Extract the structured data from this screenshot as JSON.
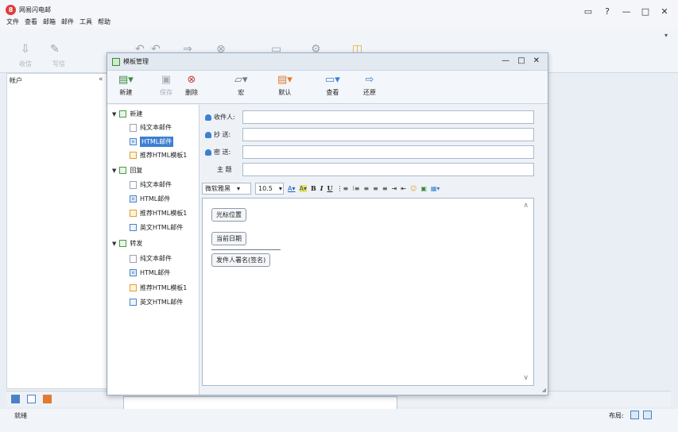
{
  "app": {
    "title": "网易闪电邮",
    "logo_glyph": "8"
  },
  "menu": [
    "文件",
    "查看",
    "邮箱",
    "邮件",
    "工具",
    "帮助"
  ],
  "window_controls": [
    "▭",
    "?",
    "—",
    "□",
    "✕"
  ],
  "main_toolbar_ghost": {
    "receive_label": "收信",
    "write_label": "写信"
  },
  "accounts": {
    "label": "帐户",
    "collapse": "«"
  },
  "right_scroll": "▾",
  "dialog": {
    "title": "模板管理",
    "controls": [
      "—",
      "□",
      "✕"
    ],
    "toolbar": [
      {
        "label": "新建",
        "icon": "new-icon",
        "enabled": true
      },
      {
        "label": "保存",
        "icon": "save-icon",
        "enabled": false
      },
      {
        "label": "删除",
        "icon": "delete-icon",
        "enabled": true
      },
      {
        "label": "宏",
        "icon": "macro-icon",
        "enabled": true
      },
      {
        "label": "默认",
        "icon": "default-icon",
        "enabled": true
      },
      {
        "label": "查看",
        "icon": "view-icon",
        "enabled": true
      },
      {
        "label": "还原",
        "icon": "restore-icon",
        "enabled": true
      }
    ],
    "tree": [
      {
        "label": "新建",
        "children": [
          "纯文本邮件",
          "HTML邮件",
          "推荐HTML模板1"
        ]
      },
      {
        "label": "回复",
        "children": [
          "纯文本邮件",
          "HTML邮件",
          "推荐HTML模板1",
          "英文HTML邮件"
        ]
      },
      {
        "label": "转发",
        "children": [
          "纯文本邮件",
          "HTML邮件",
          "推荐HTML模板1",
          "英文HTML邮件"
        ]
      }
    ],
    "selected_item": "HTML邮件",
    "form": {
      "to": "收件人:",
      "cc": "抄 送:",
      "bcc": "密 送:",
      "subject": "主 题"
    },
    "format": {
      "font": "微软雅黑",
      "size": "10.5"
    },
    "editor_buttons": [
      "光标位置",
      "当前日期",
      "发件人署名(签名)"
    ]
  },
  "status": {
    "text": "就绪",
    "layout_label": "布局:"
  }
}
